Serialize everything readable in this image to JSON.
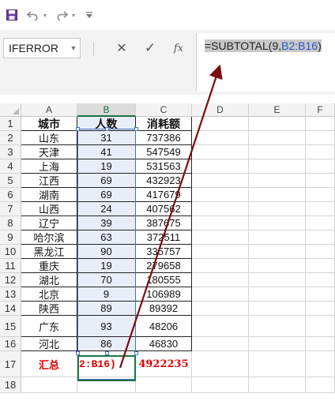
{
  "quick_access": {
    "save_icon": "save-icon",
    "undo_icon": "undo-icon",
    "redo_icon": "redo-icon",
    "customize_icon": "customize-toolbar-icon"
  },
  "formula_bar": {
    "name_box": "IFERROR",
    "cancel_glyph": "✕",
    "enter_glyph": "✓",
    "fx_label": "fx",
    "formula_prefix": "=SUBTOTAL(9,",
    "formula_ref": "B2:B16",
    "formula_suffix": ")"
  },
  "columns": [
    "A",
    "B",
    "C",
    "D",
    "E",
    "F"
  ],
  "rows": [
    "1",
    "2",
    "3",
    "4",
    "5",
    "6",
    "7",
    "8",
    "9",
    "10",
    "11",
    "12",
    "13",
    "14",
    "15",
    "16",
    "17",
    "18"
  ],
  "table": {
    "headers": [
      "城市",
      "人数",
      "消耗额"
    ],
    "data": [
      [
        "山东",
        "31",
        "737386"
      ],
      [
        "天津",
        "41",
        "547549"
      ],
      [
        "上海",
        "19",
        "531563"
      ],
      [
        "江西",
        "69",
        "432923"
      ],
      [
        "湖南",
        "69",
        "417679"
      ],
      [
        "山西",
        "24",
        "407562"
      ],
      [
        "辽宁",
        "39",
        "387675"
      ],
      [
        "哈尔滨",
        "63",
        "372511"
      ],
      [
        "黑龙江",
        "90",
        "335757"
      ],
      [
        "重庆",
        "19",
        "279658"
      ],
      [
        "湖北",
        "70",
        "180555"
      ],
      [
        "北京",
        "9",
        "106989"
      ],
      [
        "陕西",
        "89",
        "89392"
      ],
      [
        "广东",
        "93",
        "48206"
      ],
      [
        "河北",
        "86",
        "46830"
      ]
    ],
    "total_label": "汇总",
    "total_b_editing": "2:B16)",
    "total_c": "4922235"
  },
  "colors": {
    "accent_green": "#217346",
    "selection_blue": "#4472c4",
    "arrow": "#7b0d0d",
    "total_red": "#e00000"
  }
}
